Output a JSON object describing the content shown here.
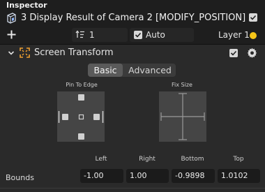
{
  "header": {
    "title": "Inspector"
  },
  "node": {
    "name": "3  Display Result of Camera 2 [MODIFY_POSITION]",
    "enabled": true
  },
  "toolbar": {
    "add_icon": "plus-icon",
    "order_value": "1",
    "auto_label": "Auto",
    "auto_checked": true,
    "layer_label": "Layer 1",
    "layer_color": "#f5c518"
  },
  "section": {
    "title": "Screen Transform",
    "enabled": true,
    "tabs": [
      {
        "label": "Basic",
        "active": true
      },
      {
        "label": "Advanced",
        "active": false
      }
    ],
    "pin_to_edge_label": "Pin To Edge",
    "fix_size_label": "Fix Size",
    "bounds": {
      "label": "Bounds",
      "columns": [
        "Left",
        "Right",
        "Bottom",
        "Top"
      ],
      "values": [
        "-1.00",
        "1.00",
        "-0.9898",
        "1.0102"
      ]
    }
  },
  "colors": {
    "accent": "#f5c518",
    "icon_orange": "#f0a030",
    "panel_bg": "#2a2a2a"
  }
}
